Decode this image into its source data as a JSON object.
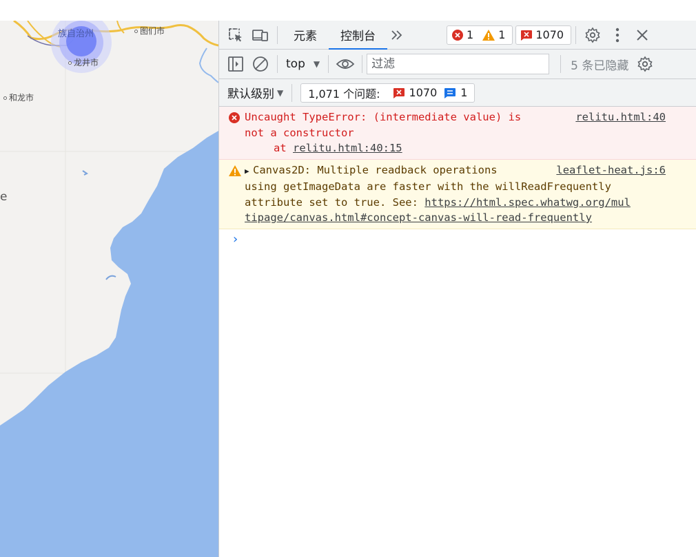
{
  "map": {
    "labels": [
      {
        "text": "族自治州",
        "kind": "region"
      },
      {
        "text": "图们市",
        "kind": "city"
      },
      {
        "text": "龙井市",
        "kind": "city"
      },
      {
        "text": "和龙市",
        "kind": "city"
      },
      {
        "text": "e",
        "kind": "fragment"
      }
    ],
    "colors": {
      "land": "#f3f2f0",
      "sea": "#93b9ec",
      "road": "#f0c040",
      "border": "#6a6aa8",
      "heat": "#6b7cf7"
    }
  },
  "devtools": {
    "tabs": [
      {
        "label": "元素",
        "active": false
      },
      {
        "label": "控制台",
        "active": true
      }
    ],
    "more_tabs_icon": "chevron-double-right-icon",
    "counts": {
      "errors": "1",
      "warnings": "1",
      "issues": "1070"
    },
    "context": "top",
    "filter_placeholder": "过滤",
    "hidden_count": "5 条已隐藏",
    "levels_label": "默认级别",
    "issues_label": "1,071 个问题:",
    "issues_errors": "1070",
    "issues_info": "1",
    "messages": {
      "error": {
        "line1": "Uncaught TypeError: (intermediate value) is",
        "line2": "not a constructor",
        "at_prefix": "at ",
        "at_link": "relitu.html:40:15",
        "source": "relitu.html:40"
      },
      "warning": {
        "line1": "Canvas2D: Multiple readback operations",
        "line2": "using getImageData are faster with the willReadFrequently",
        "line3_text": "attribute set to true. See: ",
        "url_part1": "https://html.spec.whatwg.org/mul",
        "url_part2": "tipage/canvas.html#concept-canvas-will-read-frequently",
        "source": "leaflet-heat.js:6"
      }
    },
    "prompt": "›",
    "colors": {
      "accent": "#1a73e8",
      "error": "#d21c1c",
      "warning": "#f29900"
    }
  }
}
